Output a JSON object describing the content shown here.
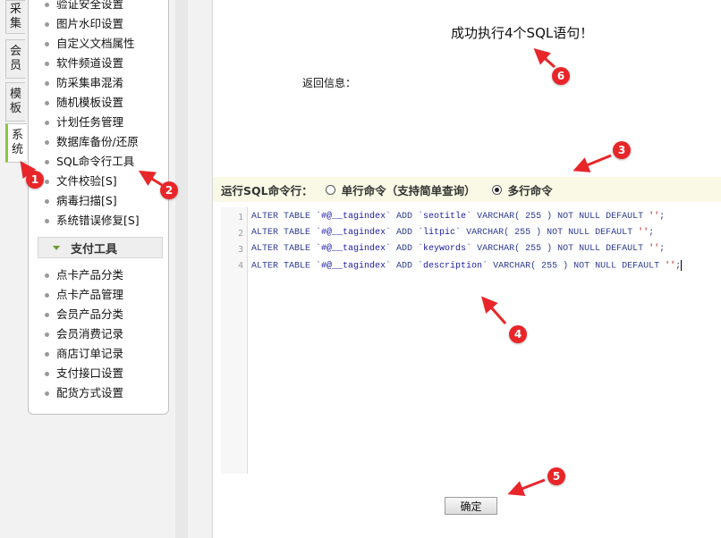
{
  "vertical_tabs": [
    {
      "label": "采集",
      "chars": [
        "采",
        "集"
      ],
      "active": false
    },
    {
      "label": "会员",
      "chars": [
        "会",
        "员"
      ],
      "active": false
    },
    {
      "label": "模板",
      "chars": [
        "模",
        "板"
      ],
      "active": false
    },
    {
      "label": "系统",
      "chars": [
        "系",
        "统"
      ],
      "active": true
    }
  ],
  "menu": {
    "items": [
      "验证安全设置",
      "图片水印设置",
      "自定义文档属性",
      "软件频道设置",
      "防采集串混淆",
      "随机模板设置",
      "计划任务管理",
      "数据库备份/还原",
      "SQL命令行工具",
      "文件校验[S]",
      "病毒扫描[S]",
      "系统错误修复[S]"
    ],
    "group_title": "支付工具",
    "group_items": [
      "点卡产品分类",
      "点卡产品管理",
      "会员产品分类",
      "会员消费记录",
      "商店订单记录",
      "支付接口设置",
      "配货方式设置"
    ]
  },
  "main": {
    "success_message": "成功执行4个SQL语句！",
    "return_info_label": "返回信息：",
    "run_label": "运行SQL命令行：",
    "options": [
      {
        "label": "单行命令（支持简单查询）",
        "checked": false
      },
      {
        "label": "多行命令",
        "checked": true
      }
    ],
    "code_lines": [
      {
        "no": "1",
        "pre": "ALTER TABLE `",
        "table": "#@__tagindex",
        "mid": "` ADD `",
        "col": "seotitle",
        "post": "` VARCHAR( 255 ) NOT NULL DEFAULT ",
        "str": "''",
        "end": ";"
      },
      {
        "no": "2",
        "pre": "ALTER TABLE `",
        "table": "#@__tagindex",
        "mid": "` ADD `",
        "col": "litpic",
        "post": "` VARCHAR( 255 ) NOT NULL DEFAULT ",
        "str": "''",
        "end": ";"
      },
      {
        "no": "3",
        "pre": "ALTER TABLE `",
        "table": "#@__tagindex",
        "mid": "` ADD `",
        "col": "keywords",
        "post": "` VARCHAR( 255 ) NOT NULL DEFAULT ",
        "str": "''",
        "end": ";"
      },
      {
        "no": "4",
        "pre": "ALTER TABLE `",
        "table": "#@__tagindex",
        "mid": "` ADD `",
        "col": "description",
        "post": "` VARCHAR( 255 ) NOT NULL DEFAULT ",
        "str": "''",
        "end": ";"
      }
    ],
    "ok_button": "确定"
  },
  "annotations": [
    "1",
    "2",
    "3",
    "4",
    "5",
    "6"
  ],
  "colors": {
    "marker": "#e8262a",
    "active_tab_accent": "#8cc63e",
    "run_bar_bg": "#f9f9e6"
  }
}
